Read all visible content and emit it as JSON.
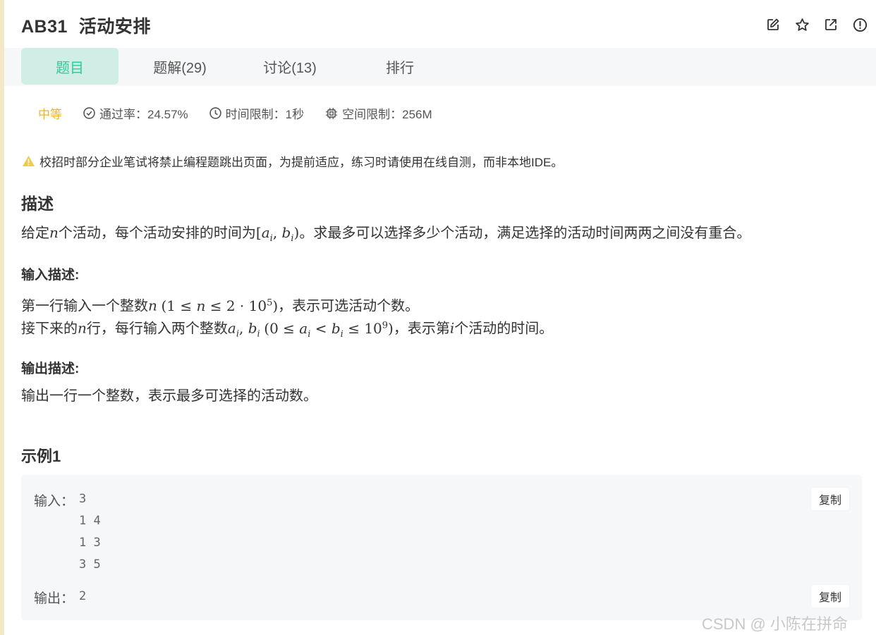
{
  "header": {
    "problem_code": "AB31",
    "problem_title": "活动安排",
    "icons": [
      "edit-icon",
      "star-icon",
      "external-link-icon",
      "alert-icon"
    ]
  },
  "tabs": [
    {
      "label": "题目",
      "active": true
    },
    {
      "label": "题解(29)",
      "active": false
    },
    {
      "label": "讨论(13)",
      "active": false
    },
    {
      "label": "排行",
      "active": false
    }
  ],
  "meta": {
    "difficulty": "中等",
    "pass_rate": "通过率：24.57%",
    "time_limit": "时间限制：1秒",
    "memory_limit": "空间限制：256M"
  },
  "notice": "校招时部分企业笔试将禁止编程题跳出页面，为提前适应，练习时请使用在线自测，而非本地IDE。",
  "description": {
    "heading": "描述",
    "text_part1": "给定",
    "var_n": "n",
    "text_part2": "个活动，每个活动安排的时间为",
    "interval": "[a_i, b_i)",
    "text_part3": "。求最多可以选择多少个活动，满足选择的活动时间两两之间没有重合。"
  },
  "input_desc": {
    "heading": "输入描述:",
    "line1_prefix": "第一行输入一个整数",
    "line1_suffix": "，表示可选活动个数。",
    "line2_prefix": "接下来的",
    "line2_mid1": "行，每行输入两个整数",
    "line2_mid2": "，表示第",
    "line2_suffix": "个活动的时间。"
  },
  "output_desc": {
    "heading": "输出描述:",
    "text": "输出一行一个整数，表示最多可选择的活动数。"
  },
  "example": {
    "heading": "示例1",
    "input_label": "输入：",
    "input_lines": [
      "3",
      "1 4",
      "1 3",
      "3 5"
    ],
    "output_label": "输出：",
    "output_value": "2",
    "copy_label": "复制"
  },
  "watermark": "CSDN @  小陈在拼命",
  "colors": {
    "accent_green": "#32ca99",
    "tab_active_bg": "#d0eee5",
    "difficulty_yellow": "#f0b51e",
    "warning_yellow": "#f2c94c"
  }
}
